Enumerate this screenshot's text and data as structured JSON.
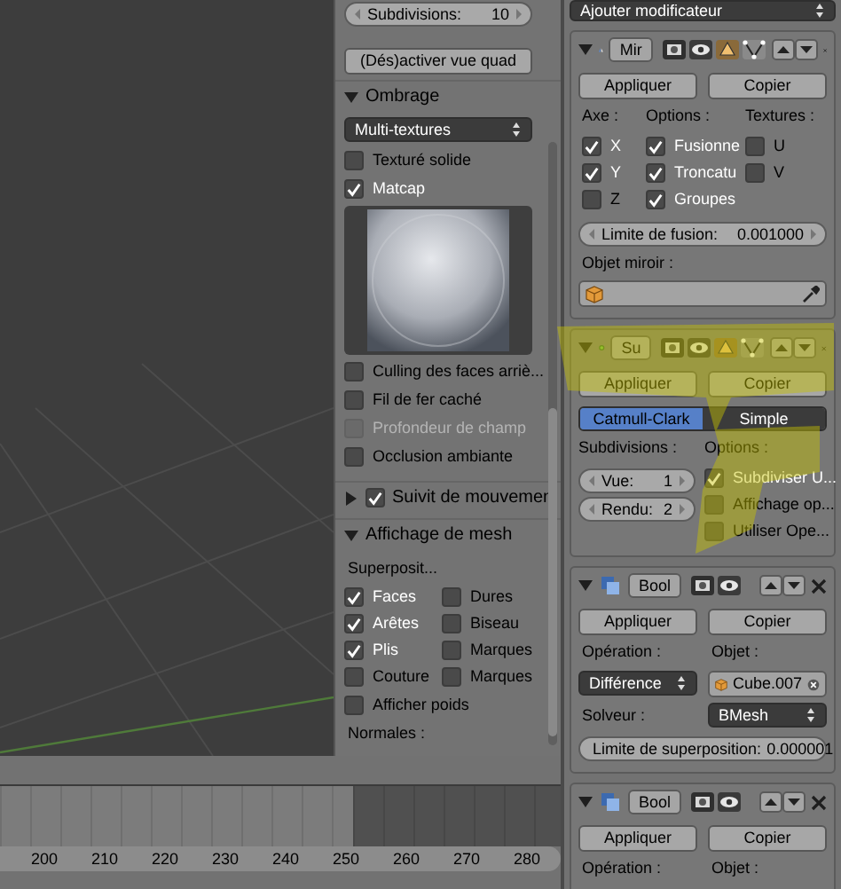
{
  "n_panel": {
    "subdivisions": {
      "label": "Subdivisions:",
      "value": "10"
    },
    "quad_view_button": "(Dés)activer vue quad",
    "sections": [
      {
        "title": "Ombrage",
        "expanded": true,
        "items": [
          {
            "kind": "dropdown",
            "value": "Multi-textures"
          },
          {
            "kind": "checkbox",
            "label": "Texturé solide",
            "checked": false,
            "disabled": false
          },
          {
            "kind": "checkbox",
            "label": "Matcap",
            "checked": true,
            "disabled": false
          },
          {
            "kind": "matcap"
          },
          {
            "kind": "checkbox",
            "label": "Culling des faces arriè...",
            "checked": false,
            "disabled": false
          },
          {
            "kind": "checkbox",
            "label": "Fil de fer caché",
            "checked": false,
            "disabled": false
          },
          {
            "kind": "checkbox",
            "label": "Profondeur de champ",
            "checked": false,
            "disabled": true
          },
          {
            "kind": "checkbox",
            "label": "Occlusion ambiante",
            "checked": false,
            "disabled": false
          }
        ]
      },
      {
        "title": "Suivit de mouvemen",
        "expanded": false,
        "checked": true
      },
      {
        "title": "Affichage de mesh",
        "expanded": true,
        "items": [
          {
            "kind": "label",
            "text": "Superposit..."
          },
          {
            "kind": "check_grid",
            "checks": [
              {
                "label": "Faces",
                "checked": true
              },
              {
                "label": "Dures",
                "checked": false
              },
              {
                "label": "Arêtes",
                "checked": true
              },
              {
                "label": "Biseau",
                "checked": false
              },
              {
                "label": "Plis",
                "checked": true
              },
              {
                "label": "Marques",
                "checked": false
              },
              {
                "label": "Couture",
                "checked": false
              },
              {
                "label": "Marques",
                "checked": false
              }
            ]
          },
          {
            "kind": "checkbox",
            "label": "Afficher poids",
            "checked": false,
            "disabled": false
          },
          {
            "kind": "label",
            "text": "Normales :"
          }
        ]
      }
    ]
  },
  "timeline": {
    "ticks": [
      "200",
      "210",
      "220",
      "230",
      "240",
      "250",
      "260",
      "270",
      "280"
    ]
  },
  "properties": {
    "add_modifier": "Ajouter modificateur",
    "modifiers": [
      {
        "kind": "mirror",
        "name": "Mir",
        "apply": "Appliquer",
        "copy": "Copier",
        "toggles": [
          {
            "kind": "render"
          },
          {
            "kind": "view"
          },
          {
            "kind": "edit"
          },
          {
            "kind": "cage"
          }
        ],
        "columns": [
          {
            "title": "Axe :",
            "checks": [
              {
                "label": "X",
                "checked": true
              },
              {
                "label": "Y",
                "checked": true
              },
              {
                "label": "Z",
                "checked": false
              }
            ]
          },
          {
            "title": "Options :",
            "checks": [
              {
                "label": "Fusionne",
                "checked": true
              },
              {
                "label": "Troncatu",
                "checked": true
              },
              {
                "label": "Groupes",
                "checked": true
              }
            ]
          },
          {
            "title": "Textures :",
            "checks": [
              {
                "label": "U",
                "checked": false
              },
              {
                "label": "V",
                "checked": false
              }
            ]
          }
        ],
        "limit": {
          "label": "Limite de fusion:",
          "value": "0.001000"
        },
        "object_label": "Objet miroir :"
      },
      {
        "kind": "subsurf",
        "name": "Su",
        "apply": "Appliquer",
        "copy": "Copier",
        "toggles": [
          {
            "kind": "render"
          },
          {
            "kind": "view"
          },
          {
            "kind": "edit"
          },
          {
            "kind": "cage"
          }
        ],
        "modes": [
          {
            "label": "Catmull-Clark",
            "selected": true
          },
          {
            "label": "Simple",
            "selected": false
          }
        ],
        "left_title": "Subdivisions :",
        "levels": [
          {
            "label": "Vue:",
            "value": "1"
          },
          {
            "label": "Rendu:",
            "value": "2"
          }
        ],
        "right_title": "Options :",
        "options": [
          {
            "label": "Subdiviser U...",
            "checked": true
          },
          {
            "label": "Affichage op...",
            "checked": false
          },
          {
            "label": "Utiliser Ope...",
            "checked": false
          }
        ]
      },
      {
        "kind": "boolean",
        "name": "Bool",
        "apply": "Appliquer",
        "copy": "Copier",
        "toggles": [
          {
            "kind": "render"
          },
          {
            "kind": "view"
          }
        ],
        "operation_label": "Opération :",
        "operation": "Différence",
        "object_label": "Objet :",
        "object": "Cube.007",
        "solver_label": "Solveur :",
        "solver": "BMesh",
        "limit": {
          "label": "Limite de superposition:",
          "value": "0.000001"
        }
      },
      {
        "kind": "boolean",
        "name": "Bool",
        "apply": "Appliquer",
        "copy": "Copier",
        "toggles": [
          {
            "kind": "render"
          },
          {
            "kind": "view"
          }
        ],
        "operation_label": "Opération :",
        "object_label": "Objet :"
      }
    ]
  }
}
